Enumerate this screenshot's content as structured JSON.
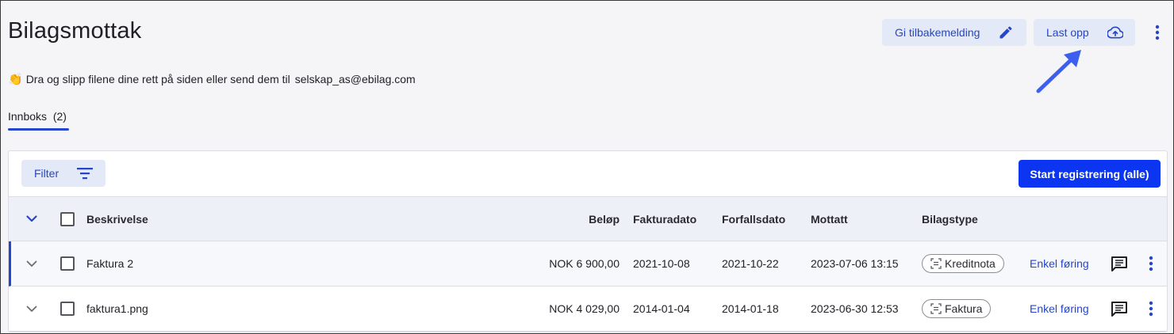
{
  "header": {
    "title": "Bilagsmottak",
    "feedback_label": "Gi tilbakemelding",
    "upload_label": "Last opp",
    "hint_icon": "👏",
    "hint_text": "Dra og slipp filene dine rett på siden eller send dem til",
    "hint_email": "selskap_as@ebilag.com"
  },
  "tabs": [
    {
      "label": "Innboks  (2)"
    }
  ],
  "toolbar": {
    "filter_label": "Filter",
    "start_label": "Start registrering (alle)"
  },
  "table": {
    "columns": {
      "description": "Beskrivelse",
      "amount": "Beløp",
      "invoice_date": "Fakturadato",
      "due_date": "Forfallsdato",
      "received": "Mottatt",
      "doc_type": "Bilagstype"
    },
    "rows": [
      {
        "description": "Faktura 2",
        "amount": "NOK 6 900,00",
        "invoice_date": "2021-10-08",
        "due_date": "2021-10-22",
        "received": "2023-07-06 13:15",
        "doc_type": "Kreditnota",
        "action": "Enkel føring"
      },
      {
        "description": "faktura1.png",
        "amount": "NOK 4 029,00",
        "invoice_date": "2014-01-04",
        "due_date": "2014-01-18",
        "received": "2023-06-30 12:53",
        "doc_type": "Faktura",
        "action": "Enkel føring"
      }
    ]
  },
  "colors": {
    "accent": "#2546c8",
    "primary_button": "#0b35f0",
    "soft_button": "#e4e9f8",
    "annotation_arrow": "#3d5ff0"
  },
  "icons": {
    "feedback": "pencil-icon",
    "upload": "cloud-upload-icon",
    "more": "kebab-icon",
    "filter": "filter-lines-icon",
    "expand": "chevron-down-icon",
    "comment": "comment-icon",
    "doc_type": "document-scan-icon"
  }
}
